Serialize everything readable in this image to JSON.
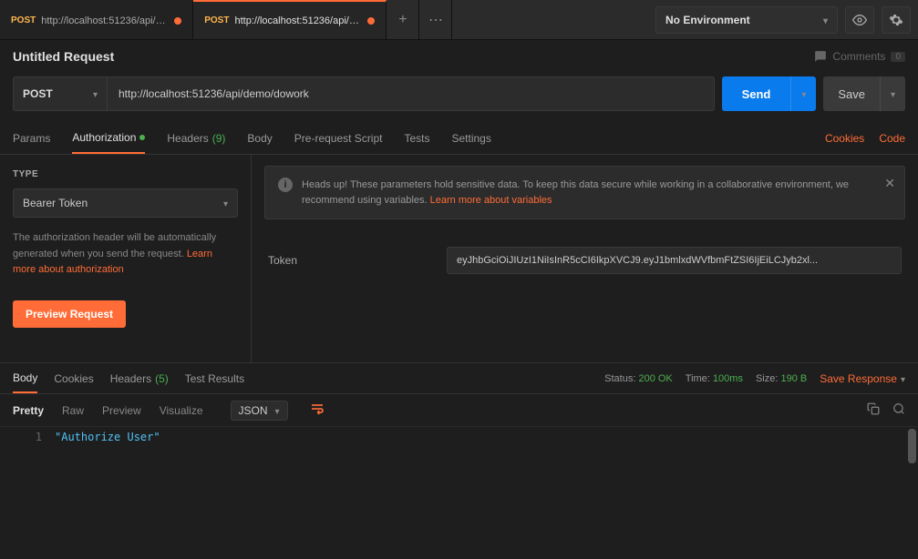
{
  "topbar": {
    "tabs": [
      {
        "method": "POST",
        "url": "http://localhost:51236/api/de...",
        "unsaved": true
      },
      {
        "method": "POST",
        "url": "http://localhost:51236/api/de...",
        "unsaved": true
      }
    ],
    "environment": "No Environment"
  },
  "request": {
    "title": "Untitled Request",
    "comments_label": "Comments",
    "comments_count": "0",
    "method": "POST",
    "url": "http://localhost:51236/api/demo/dowork",
    "send": "Send",
    "save": "Save"
  },
  "req_tabs": {
    "params": "Params",
    "authorization": "Authorization",
    "headers": "Headers",
    "headers_count": "(9)",
    "body": "Body",
    "prerequest": "Pre-request Script",
    "tests": "Tests",
    "settings": "Settings",
    "cookies": "Cookies",
    "code": "Code"
  },
  "auth": {
    "type_label": "TYPE",
    "type_value": "Bearer Token",
    "description_prefix": "The authorization header will be automatically generated when you send the request. ",
    "learn_more": "Learn more about authorization",
    "preview": "Preview Request",
    "banner_text": "Heads up! These parameters hold sensitive data. To keep this data secure while working in a collaborative environment, we recommend using variables. ",
    "banner_link": "Learn more about variables",
    "token_label": "Token",
    "token_value": "eyJhbGciOiJIUzI1NiIsInR5cCI6IkpXVCJ9.eyJ1bmlxdWVfbmFtZSI6IjEiLCJyb2xl..."
  },
  "response": {
    "tabs": {
      "body": "Body",
      "cookies": "Cookies",
      "headers": "Headers",
      "headers_count": "(5)",
      "tests": "Test Results"
    },
    "status_label": "Status:",
    "status_value": "200 OK",
    "time_label": "Time:",
    "time_value": "100ms",
    "size_label": "Size:",
    "size_value": "190 B",
    "save_response": "Save Response"
  },
  "viewer": {
    "pretty": "Pretty",
    "raw": "Raw",
    "preview": "Preview",
    "visualize": "Visualize",
    "format": "JSON"
  },
  "body_content": {
    "line1_num": "1",
    "line1_text": "\"Authorize User\""
  }
}
